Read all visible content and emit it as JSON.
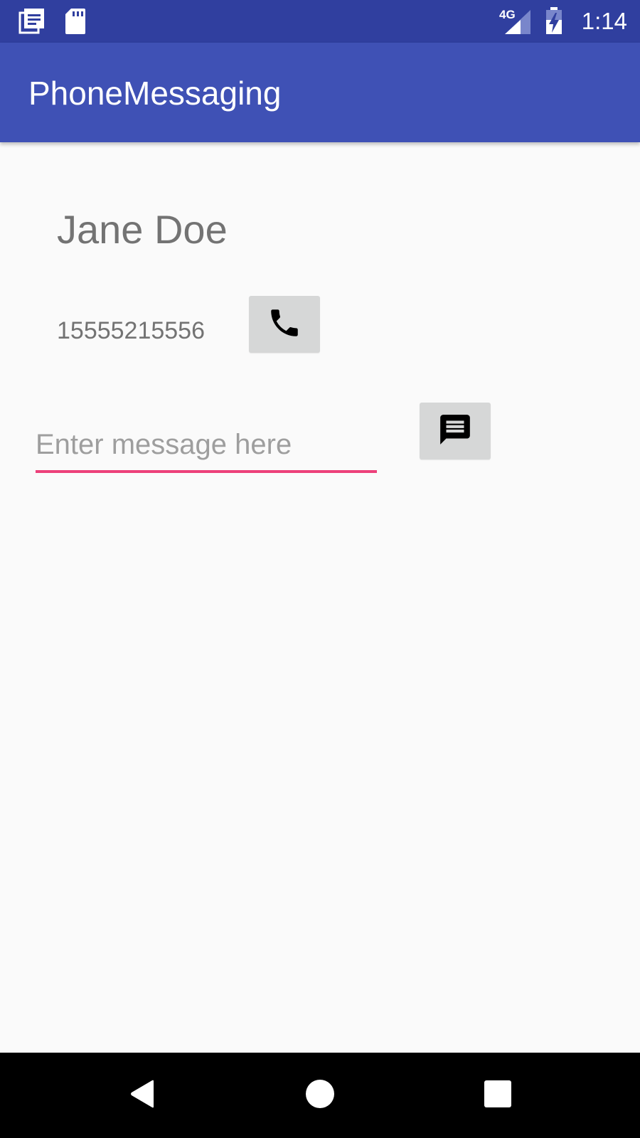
{
  "status_bar": {
    "time": "1:14",
    "network": "4G",
    "icons": [
      "notes-notification-icon",
      "sd-card-icon",
      "signal-icon",
      "battery-charging-icon"
    ]
  },
  "app_bar": {
    "title": "PhoneMessaging"
  },
  "contact": {
    "name": "Jane Doe",
    "phone": "15555215556"
  },
  "message": {
    "value": "",
    "placeholder": "Enter message here"
  },
  "colors": {
    "status_bar": "#303f9f",
    "primary": "#3f51b5",
    "accent": "#ec407a",
    "button_bg": "#d6d7d7",
    "background": "#fafafa"
  },
  "nav_bar": {
    "buttons": [
      "back-icon",
      "home-icon",
      "recents-icon"
    ]
  }
}
